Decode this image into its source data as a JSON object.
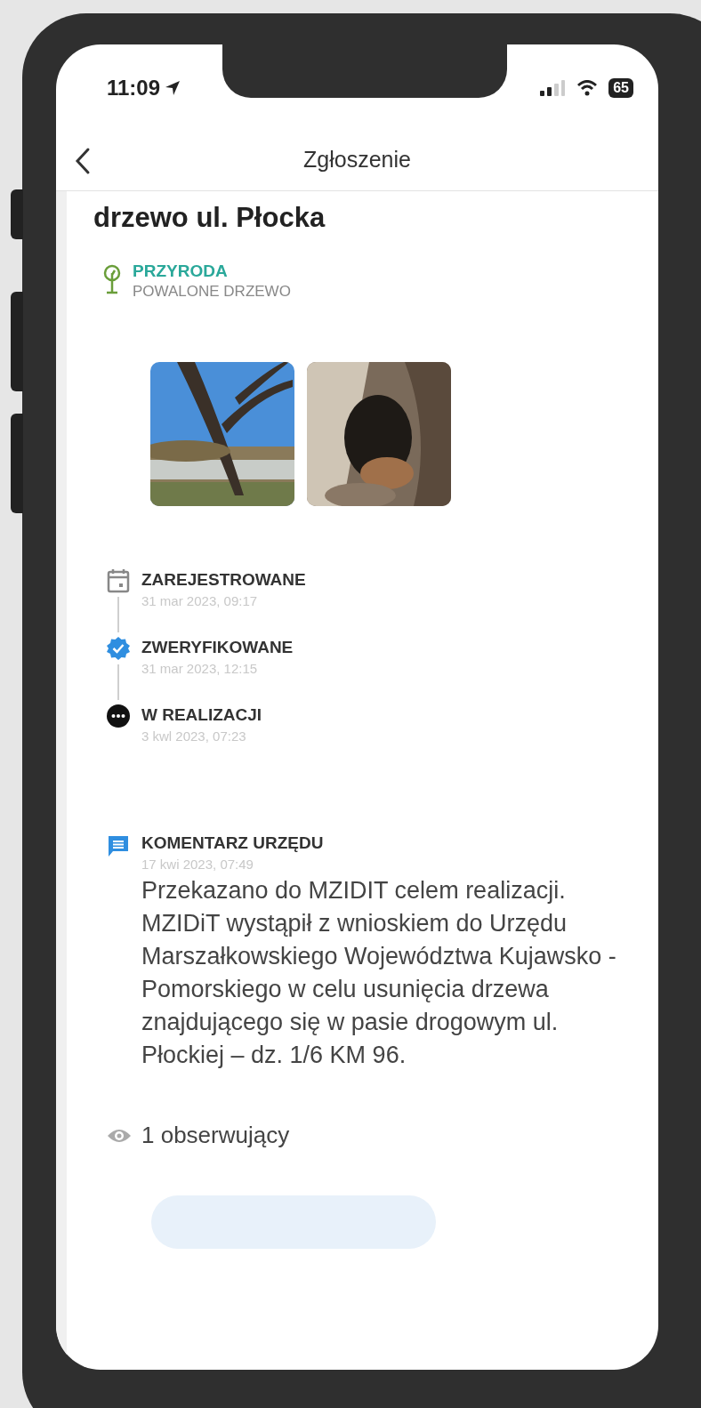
{
  "status_bar": {
    "time": "11:09",
    "battery": "65"
  },
  "nav": {
    "title": "Zgłoszenie"
  },
  "report": {
    "title": "drzewo ul. Płocka",
    "category": "PRZYRODA",
    "subcategory": "POWALONE DRZEWO"
  },
  "timeline": [
    {
      "kind": "registered",
      "label": "ZAREJESTROWANE",
      "date": "31 mar 2023, 09:17"
    },
    {
      "kind": "verified",
      "label": "ZWERYFIKOWANE",
      "date": "31 mar 2023, 12:15"
    },
    {
      "kind": "in_progress",
      "label": "W REALIZACJI",
      "date": "3 kwl 2023, 07:23"
    }
  ],
  "comment": {
    "label": "KOMENTARZ URZĘDU",
    "date": "17 kwi 2023, 07:49",
    "text": "Przekazano do MZIDIT celem realizacji.\nMZIDiT wystąpił z wnioskiem do Urzędu Marszałkowskiego Województwa Kujawsko - Pomorskiego w celu usunięcia drzewa znajdującego się w pasie drogowym ul. Płockiej – dz. 1/6 KM 96."
  },
  "followers": "1 obserwujący"
}
